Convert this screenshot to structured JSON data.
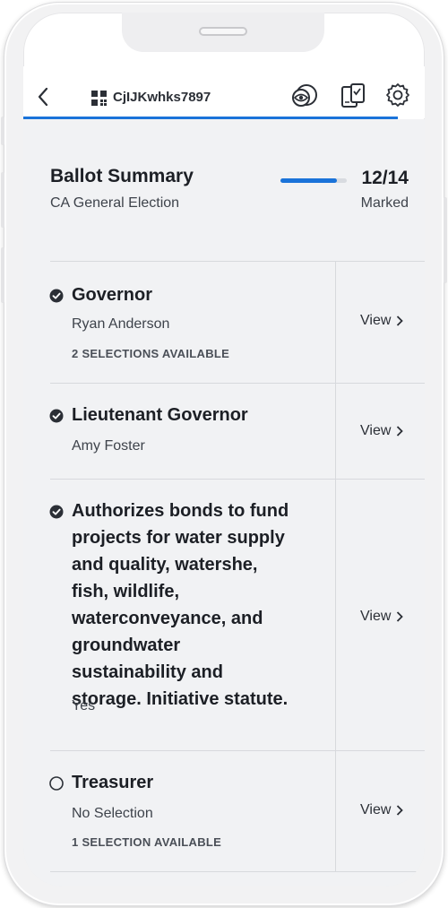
{
  "header": {
    "ballot_id": "CjIJKwhks7897",
    "icons": [
      "back-chevron-icon",
      "qr-code-icon",
      "audio-visual-icon",
      "ballot-device-icon",
      "gear-icon"
    ]
  },
  "summary": {
    "title": "Ballot Summary",
    "subtitle": "CA General Election",
    "count": "12/14",
    "count_label": "Marked",
    "progress": 0.857
  },
  "contests": [
    {
      "title": "Governor",
      "selection": "Ryan Anderson",
      "available": "2 SELECTIONS AVAILABLE",
      "status": "marked",
      "view": "View"
    },
    {
      "title": "Lieutenant Governor",
      "selection": "Amy Foster",
      "available": "",
      "status": "marked",
      "view": "View"
    },
    {
      "title": "Authorizes bonds to fund projects for water supply and quality, watershe, fish, wildlife, waterconveyance, and groundwater sustainability and storage. Initiative statute.",
      "selection": "Yes",
      "available": "",
      "status": "marked",
      "view": "View"
    },
    {
      "title": "Treasurer",
      "selection": "No Selection",
      "available": "1 SELECTION AVAILABLE",
      "status": "unmarked",
      "view": "View"
    }
  ],
  "colors": {
    "accent": "#1a73d9",
    "background": "#f1f2f4",
    "text": "#1c1f25"
  }
}
